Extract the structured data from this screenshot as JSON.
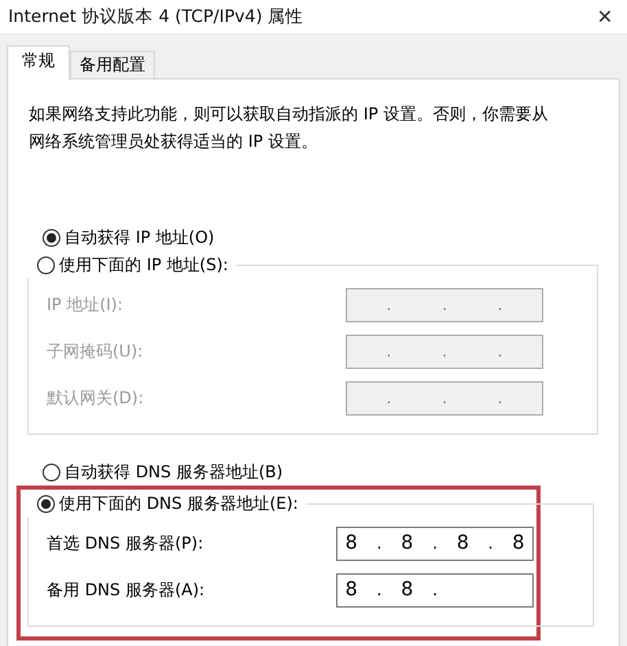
{
  "window": {
    "title": "Internet 协议版本 4 (TCP/IPv4) 属性",
    "close": "✕"
  },
  "tabs": [
    {
      "label": "常规",
      "selected": true
    },
    {
      "label": "备用配置",
      "selected": false
    }
  ],
  "description": "如果网络支持此功能，则可以获取自动指派的 IP 设置。否则，你需要从网络系统管理员处获得适当的 IP 设置。",
  "ip_separator": ".",
  "sections": [
    {
      "auto_option": {
        "label": "自动获得 IP 地址(O)",
        "selected": true
      },
      "manual_option": {
        "label": "使用下面的 IP 地址(S):",
        "selected": false
      },
      "highlighted": false,
      "fields": [
        {
          "label": "IP 地址(I):",
          "disabled": true
        },
        {
          "label": "子网掩码(U):",
          "disabled": true
        },
        {
          "label": "默认网关(D):",
          "disabled": true
        }
      ]
    },
    {
      "auto_option": {
        "label": "自动获得 DNS 服务器地址(B)",
        "selected": false
      },
      "manual_option": {
        "label": "使用下面的 DNS 服务器地址(E):",
        "selected": true
      },
      "highlighted": true,
      "fields": [
        {
          "label": "首选 DNS 服务器(P):",
          "disabled": false,
          "octets": [
            "8",
            "8",
            "8",
            "8"
          ]
        },
        {
          "label": "备用 DNS 服务器(A):",
          "disabled": false,
          "octets": [
            "8",
            "8"
          ]
        }
      ]
    }
  ]
}
